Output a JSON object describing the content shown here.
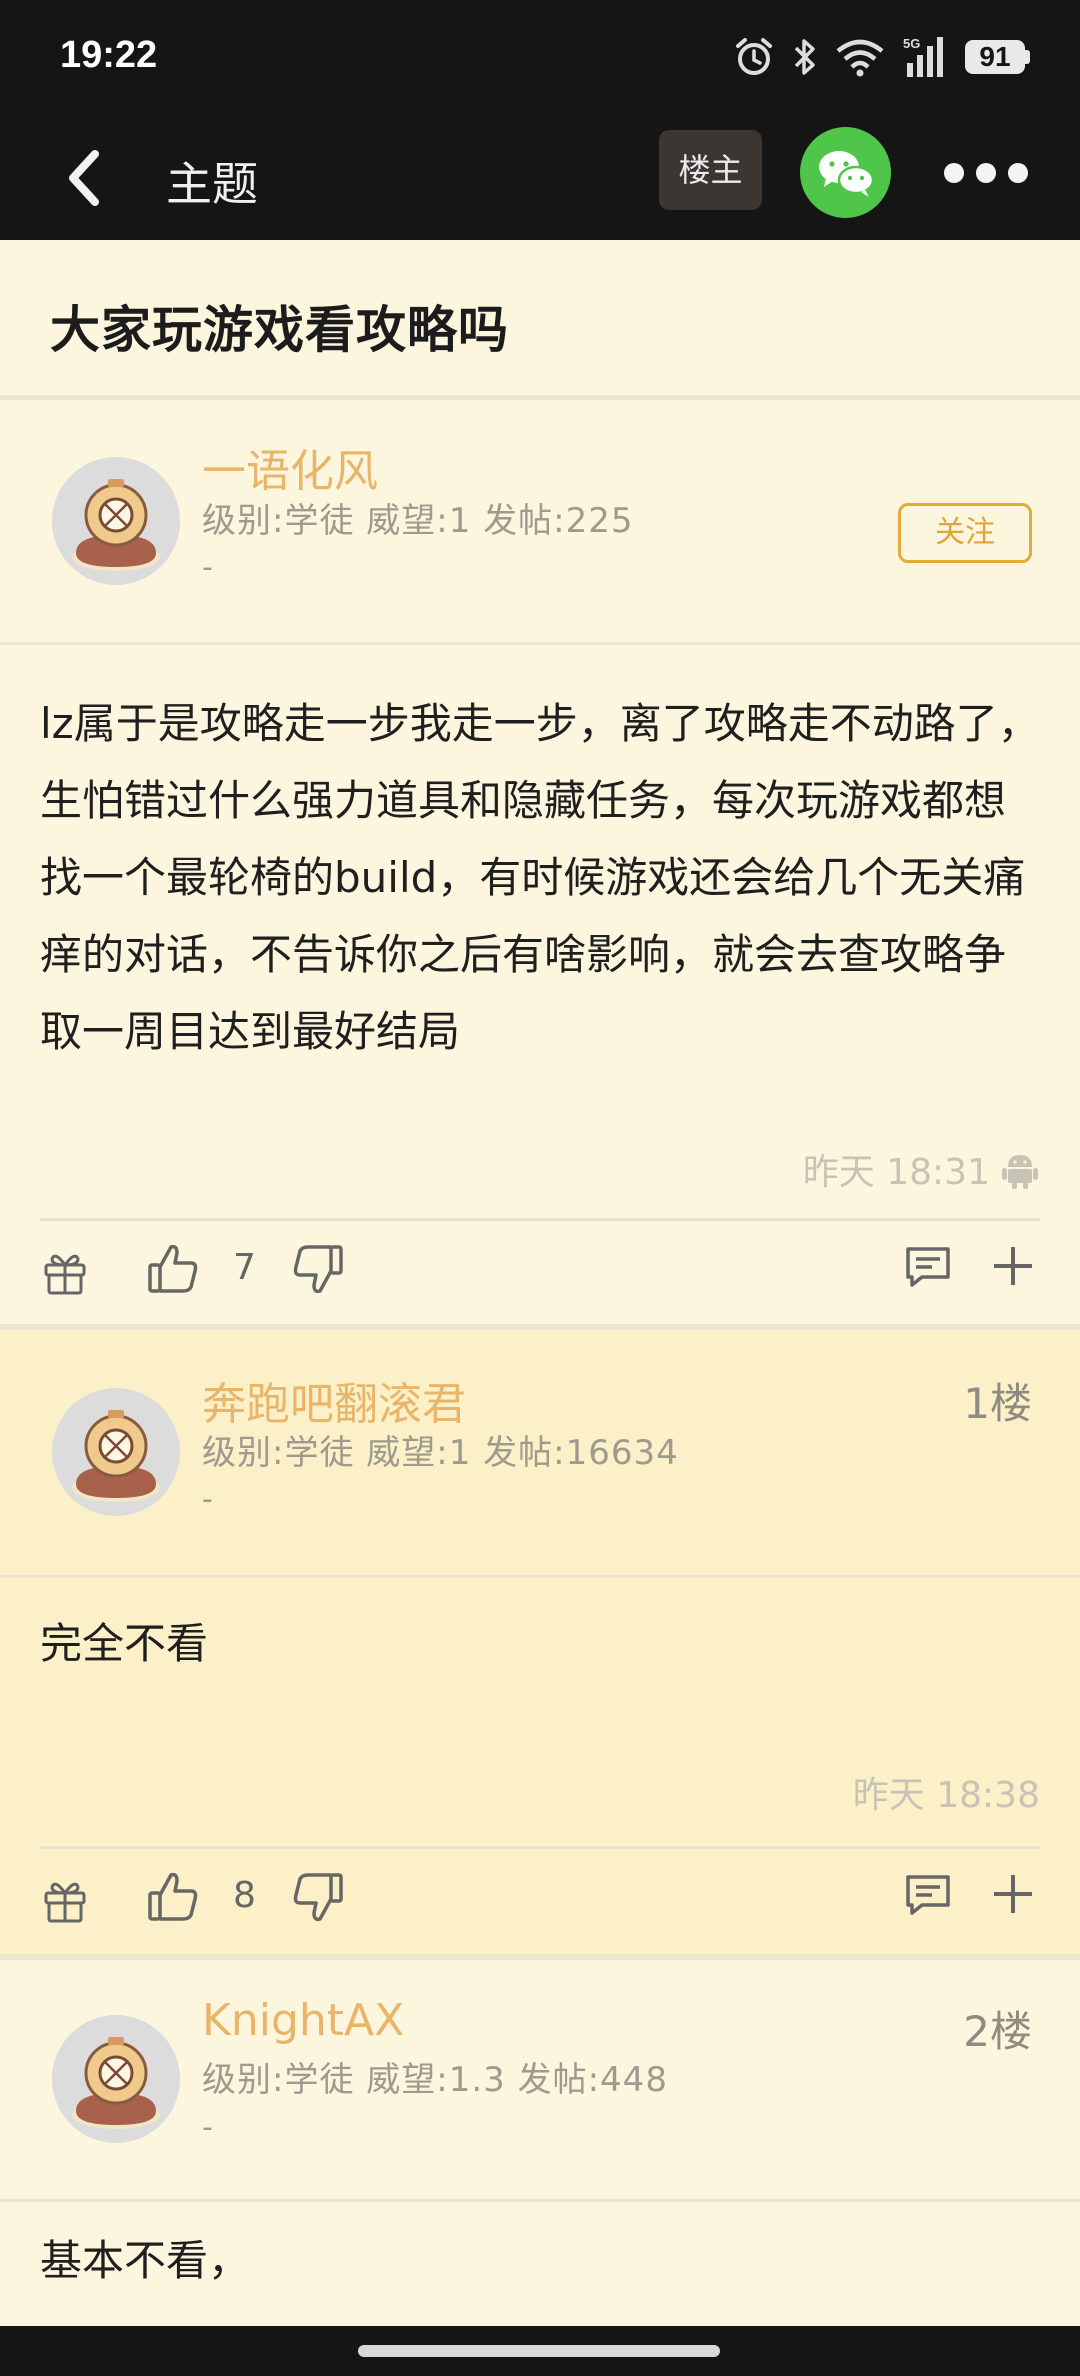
{
  "status_bar": {
    "time": "19:22",
    "network": "5G",
    "battery": "91"
  },
  "nav": {
    "title": "主题",
    "op_button": "楼主"
  },
  "topic": {
    "title": "大家玩游戏看攻略吗"
  },
  "posts": [
    {
      "username": "一语化风",
      "info": "级别:学徒 威望:1 发帖:225",
      "dash": "-",
      "follow_label": "关注",
      "content": "lz属于是攻略走一步我走一步，离了攻略走不动路了，生怕错过什么强力道具和隐藏任务，每次玩游戏都想找一个最轮椅的build，有时候游戏还会给几个无关痛痒的对话，不告诉你之后有啥影响，就会去查攻略争取一周目达到最好结局",
      "time": "昨天 18:31",
      "likes": "7"
    },
    {
      "username": "奔跑吧翻滚君",
      "info": "级别:学徒 威望:1 发帖:16634",
      "dash": "-",
      "floor": "1楼",
      "content": "完全不看",
      "time": "昨天 18:38",
      "likes": "8"
    },
    {
      "username": "KnightAX",
      "info": "级别:学徒 威望:1.3 发帖:448",
      "dash": "-",
      "floor": "2楼",
      "content": "基本不看，"
    }
  ]
}
